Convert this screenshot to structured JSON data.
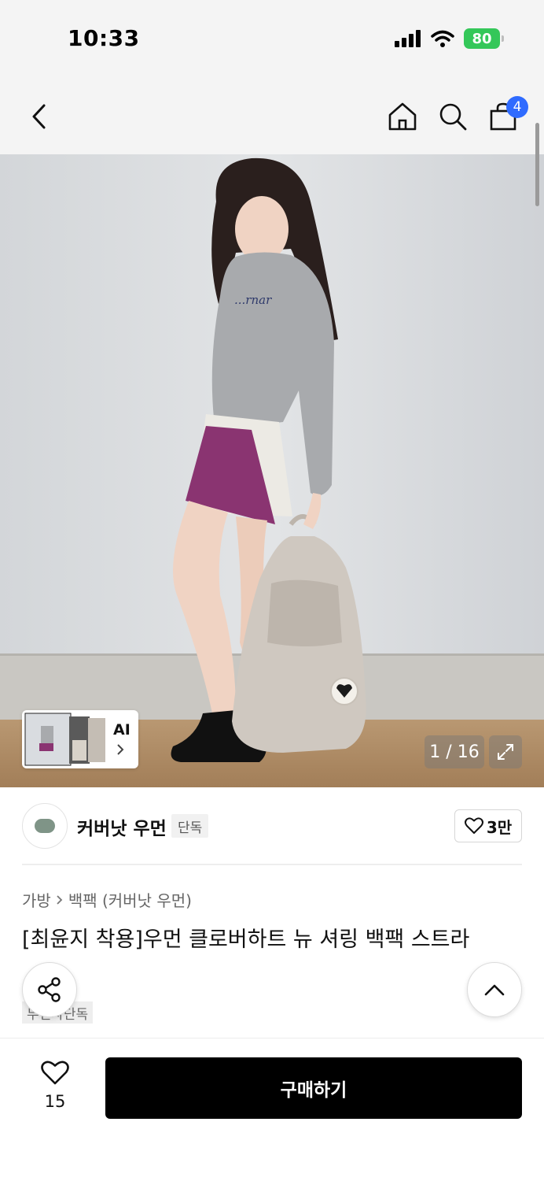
{
  "status_bar": {
    "time": "10:33",
    "battery": "80"
  },
  "nav": {
    "cart_count": "4"
  },
  "gallery": {
    "ai_label": "AI",
    "counter": "1 / 16"
  },
  "brand": {
    "name": "커버낫 우먼",
    "badge": "단독",
    "like_count": "3만"
  },
  "breadcrumb": {
    "category": "가방",
    "subcategory": "백팩 (커버낫 우먼)"
  },
  "product": {
    "title": "[최윤지 착용]우먼 클로버하트 뉴 셔링 백팩 스트라",
    "badge": "무신사단독"
  },
  "bottom_bar": {
    "wish_count": "15",
    "buy_label": "구매하기"
  },
  "colors": {
    "accent_badge": "#2f6bff",
    "battery": "#34c759",
    "buy_button": "#000000"
  },
  "icons": [
    "back-arrow-icon",
    "home-icon",
    "search-icon",
    "shopping-bag-icon",
    "expand-icon",
    "heart-icon",
    "share-icon",
    "chevron-up-icon",
    "chevron-right-icon"
  ]
}
